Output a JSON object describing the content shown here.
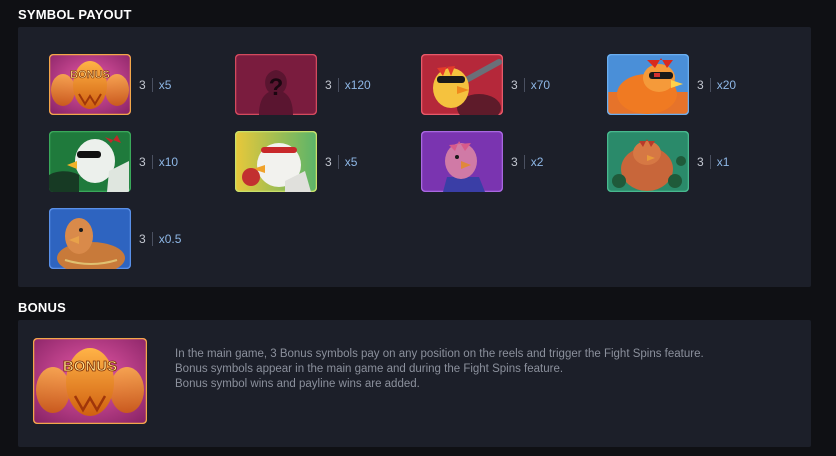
{
  "sections": {
    "payout_title": "SYMBOL PAYOUT",
    "bonus_title": "BONUS"
  },
  "symbols": [
    {
      "id": "bonus",
      "icon": "bonus-egg-icon",
      "count": "3",
      "multiplier": "x5",
      "label": "BONUS"
    },
    {
      "id": "mystery",
      "icon": "mystery-symbol-icon",
      "count": "3",
      "multiplier": "x120",
      "label": "?"
    },
    {
      "id": "rooster-bat",
      "icon": "rooster-with-bat-icon",
      "count": "3",
      "multiplier": "x70"
    },
    {
      "id": "rooster-goggles",
      "icon": "rooster-goggles-icon",
      "count": "3",
      "multiplier": "x20"
    },
    {
      "id": "rooster-sunglasses",
      "icon": "rooster-sunglasses-icon",
      "count": "3",
      "multiplier": "x10"
    },
    {
      "id": "rooster-boxer",
      "icon": "rooster-boxer-icon",
      "count": "3",
      "multiplier": "x5"
    },
    {
      "id": "rooster-purple",
      "icon": "rooster-purple-icon",
      "count": "3",
      "multiplier": "x2"
    },
    {
      "id": "rooster-fat",
      "icon": "rooster-fat-icon",
      "count": "3",
      "multiplier": "x1"
    },
    {
      "id": "rooster-muscle",
      "icon": "rooster-muscle-icon",
      "count": "3",
      "multiplier": "x0.5"
    }
  ],
  "bonus": {
    "icon": "bonus-egg-icon",
    "label": "BONUS",
    "lines": [
      "In the main game, 3 Bonus symbols pay on any position on the reels and trigger the Fight Spins feature.",
      "Bonus symbols appear in the main game and during the Fight Spins feature.",
      "Bonus symbol wins and payline wins are added."
    ]
  },
  "colors": {
    "background": "#0f1014",
    "panel": "#1c1f29",
    "multiplier": "#8eb7e6",
    "bonus_bg": "#b0357a",
    "egg": "#f0891c"
  }
}
